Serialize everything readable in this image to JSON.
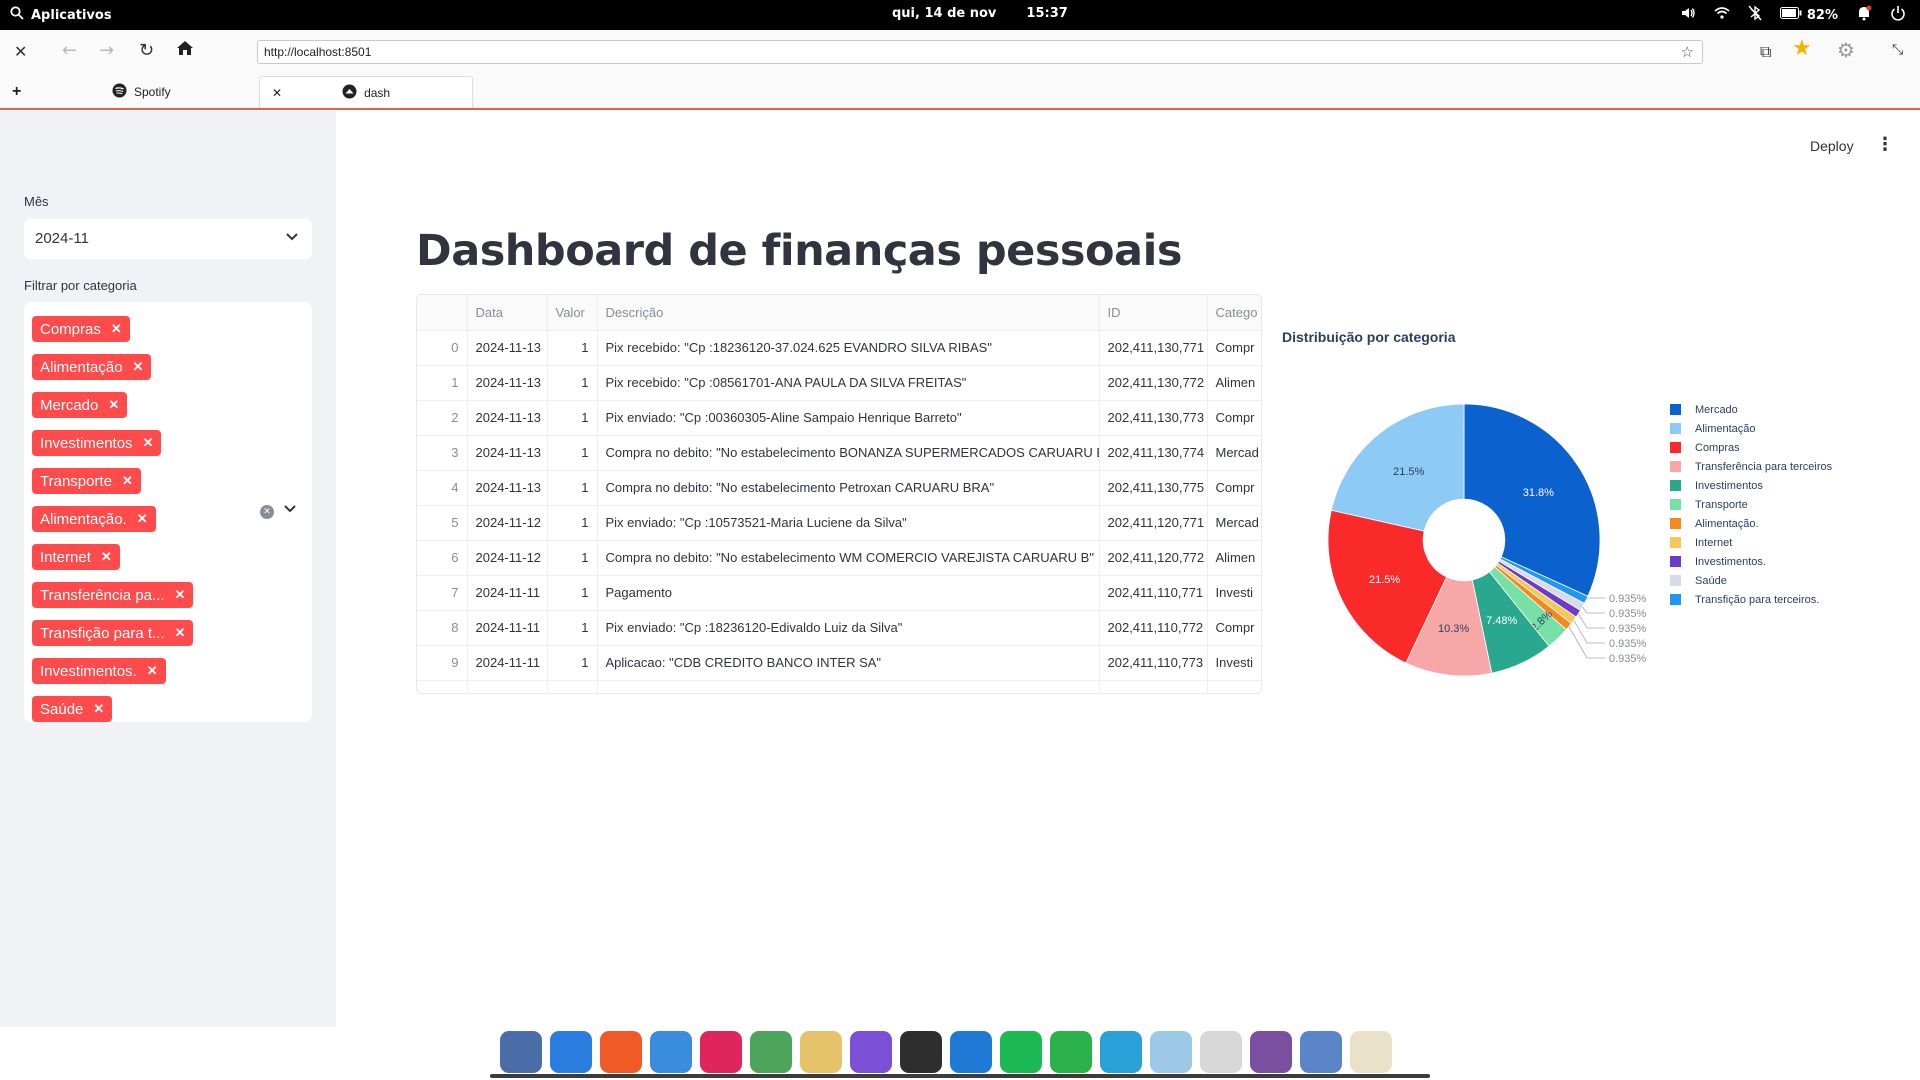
{
  "system_bar": {
    "apps_label": "Aplicativos",
    "date": "qui, 14 de nov",
    "time": "15:37",
    "battery": "82%"
  },
  "browser": {
    "url": "http://localhost:8501",
    "tabs": [
      {
        "label": "Spotify"
      },
      {
        "label": "dash"
      }
    ]
  },
  "sidebar": {
    "month_label": "Mês",
    "month_value": "2024-11",
    "filter_label": "Filtrar por categoria",
    "chips": [
      "Compras",
      "Alimentação",
      "Mercado",
      "Investimentos",
      "Transporte",
      "Alimentação.",
      "Internet",
      "Transferência pa...",
      "Transfição para t...",
      "Investimentos.",
      "Saúde"
    ]
  },
  "header": {
    "deploy_label": "Deploy",
    "menu_icon": "kebab-icon"
  },
  "main": {
    "title": "Dashboard de finanças pessoais",
    "table": {
      "columns": [
        "",
        "Data",
        "Valor",
        "Descrição",
        "ID",
        "Catego"
      ],
      "rows": [
        [
          "0",
          "2024-11-13",
          "1",
          "Pix recebido: \"Cp :18236120-37.024.625 EVANDRO SILVA RIBAS\"",
          "202,411,130,771",
          "Compr"
        ],
        [
          "1",
          "2024-11-13",
          "1",
          "Pix recebido: \"Cp :08561701-ANA PAULA DA SILVA FREITAS\"",
          "202,411,130,772",
          "Alimen"
        ],
        [
          "2",
          "2024-11-13",
          "1",
          "Pix enviado: \"Cp :00360305-Aline Sampaio Henrique Barreto\"",
          "202,411,130,773",
          "Compr"
        ],
        [
          "3",
          "2024-11-13",
          "1",
          "Compra no debito: \"No estabelecimento BONANZA SUPERMERCADOS CARUARU B\"",
          "202,411,130,774",
          "Mercad"
        ],
        [
          "4",
          "2024-11-13",
          "1",
          "Compra no debito: \"No estabelecimento Petroxan CARUARU BRA\"",
          "202,411,130,775",
          "Compr"
        ],
        [
          "5",
          "2024-11-12",
          "1",
          "Pix enviado: \"Cp :10573521-Maria Luciene da Silva\"",
          "202,411,120,771",
          "Mercad"
        ],
        [
          "6",
          "2024-11-12",
          "1",
          "Compra no debito: \"No estabelecimento WM COMERCIO VAREJISTA CARUARU B\"",
          "202,411,120,772",
          "Alimen"
        ],
        [
          "7",
          "2024-11-11",
          "1",
          "Pagamento",
          "202,411,110,771",
          "Investi"
        ],
        [
          "8",
          "2024-11-11",
          "1",
          "Pix enviado: \"Cp :18236120-Edivaldo Luiz da Silva\"",
          "202,411,110,772",
          "Compr"
        ],
        [
          "9",
          "2024-11-11",
          "1",
          "Aplicacao: \"CDB CREDITO BANCO INTER SA\"",
          "202,411,110,773",
          "Investi"
        ]
      ]
    }
  },
  "chart_data": {
    "type": "pie",
    "title": "Distribuição por categoria",
    "hole": 0.3,
    "legend_position": "right",
    "slices": [
      {
        "label": "Mercado",
        "value": 31.8,
        "text": "31.8%",
        "color": "#0b62cf"
      },
      {
        "label": "Alimentação",
        "value": 0.935,
        "text": "0.935%",
        "color": "#2196f3"
      },
      {
        "label": "Compras",
        "value": 0.935,
        "text": "0.935%",
        "color": "#d8dbe6"
      },
      {
        "label": "Transferência para terceiros",
        "value": 0.935,
        "text": "0.935%",
        "color": "#6c3cc9"
      },
      {
        "label": "Investimentos",
        "value": 0.935,
        "text": "0.935%",
        "color": "#f8c857"
      },
      {
        "label": "Transporte",
        "value": 0.935,
        "text": "0.935%",
        "color": "#f5891f"
      },
      {
        "label": "Alimentação.",
        "value": 2.8,
        "text": "2.8%",
        "color": "#77e0a4"
      },
      {
        "label": "Internet",
        "value": 7.48,
        "text": "7.48%",
        "color": "#2aa88f"
      },
      {
        "label": "Investimentos.",
        "value": 10.3,
        "text": "10.3%",
        "color": "#f7a7a7"
      },
      {
        "label": "Saúde",
        "value": 21.5,
        "text": "21.5%",
        "color": "#fb2a2a"
      },
      {
        "label": "Transfição para terceiros.",
        "value": 21.5,
        "text": "21.5%",
        "color": "#8dcaf6"
      }
    ],
    "legend": [
      {
        "label": "Mercado",
        "color": "#0b62cf"
      },
      {
        "label": "Alimentação",
        "color": "#8dcaf6"
      },
      {
        "label": "Compras",
        "color": "#fb2a2a"
      },
      {
        "label": "Transferência para terceiros",
        "color": "#f7a7a7"
      },
      {
        "label": "Investimentos",
        "color": "#2aa88f"
      },
      {
        "label": "Transporte",
        "color": "#77e0a4"
      },
      {
        "label": "Alimentação.",
        "color": "#f5891f"
      },
      {
        "label": "Internet",
        "color": "#f8c857"
      },
      {
        "label": "Investimentos.",
        "color": "#6c3cc9"
      },
      {
        "label": "Saúde",
        "color": "#d8dbe6"
      },
      {
        "label": "Transfição para terceiros.",
        "color": "#2196f3"
      }
    ]
  },
  "dock": {
    "icons": [
      {
        "name": "workspace-icon",
        "color": "#4c6ea8"
      },
      {
        "name": "browser-globe-icon",
        "color": "#2b7de0"
      },
      {
        "name": "brave-browser-icon",
        "color": "#f05a27"
      },
      {
        "name": "file-search-icon",
        "color": "#3a8dde"
      },
      {
        "name": "tasks-check-icon",
        "color": "#e0245e"
      },
      {
        "name": "system-monitor-icon",
        "color": "#4ca55a"
      },
      {
        "name": "mail-icon",
        "color": "#e6c36a"
      },
      {
        "name": "obsidian-icon",
        "color": "#7b4fd6"
      },
      {
        "name": "terminal-icon",
        "color": "#2e2e2e"
      },
      {
        "name": "vscode-icon",
        "color": "#1f7ad6"
      },
      {
        "name": "spotify-icon",
        "color": "#1db954"
      },
      {
        "name": "green-app-icon",
        "color": "#2cb24a"
      },
      {
        "name": "telegram-icon",
        "color": "#2aa0d8"
      },
      {
        "name": "llama-icon",
        "color": "#9cc9e6"
      },
      {
        "name": "calendar-icon",
        "color": "#d7d7d7"
      },
      {
        "name": "store-icon",
        "color": "#7a4fa0"
      },
      {
        "name": "toggle-settings-icon",
        "color": "#5a86c9"
      },
      {
        "name": "json-editor-icon",
        "color": "#e9e2c8"
      }
    ]
  }
}
